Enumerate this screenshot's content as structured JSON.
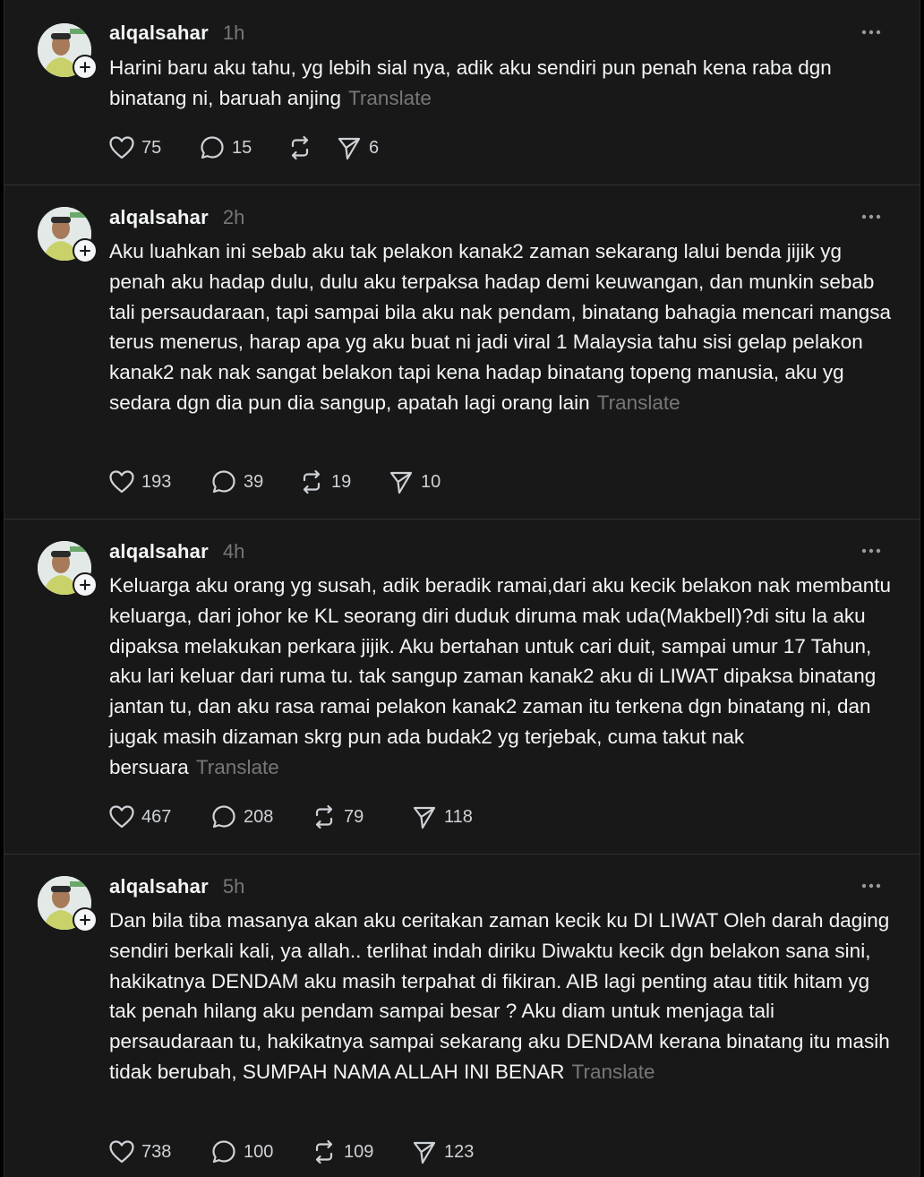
{
  "posts": [
    {
      "username": "alqalsahar",
      "time": "1h",
      "text": "Harini baru aku tahu, yg lebih sial nya, adik aku sendiri pun penah kena raba dgn binatang ni, baruah anjing",
      "translate_label": "Translate",
      "likes": "75",
      "replies": "15",
      "reposts": "",
      "shares": "6"
    },
    {
      "username": "alqalsahar",
      "time": "2h",
      "text": "Aku luahkan ini sebab aku tak pelakon kanak2 zaman sekarang lalui benda jijik yg penah aku hadap dulu, dulu aku terpaksa hadap demi keuwangan, dan munkin sebab tali persaudaraan, tapi sampai bila aku nak pendam, binatang bahagia mencari mangsa terus menerus, harap apa yg aku buat ni jadi viral 1 Malaysia tahu sisi gelap pelakon kanak2 nak nak sangat belakon tapi kena hadap binatang topeng manusia, aku yg sedara dgn dia pun dia sangup, apatah lagi orang lain",
      "translate_label": "Translate",
      "likes": "193",
      "replies": "39",
      "reposts": "19",
      "shares": "10"
    },
    {
      "username": "alqalsahar",
      "time": "4h",
      "text": "Keluarga aku orang yg susah, adik beradik ramai,dari aku kecik belakon nak membantu keluarga, dari johor ke KL seorang diri duduk diruma mak uda(Makbell)?di situ la aku dipaksa melakukan perkara jijik. Aku bertahan untuk cari duit, sampai umur 17 Tahun, aku lari keluar dari ruma tu. tak sangup zaman kanak2 aku di LIWAT dipaksa binatang jantan tu, dan aku rasa ramai pelakon kanak2 zaman itu terkena dgn binatang ni, dan jugak masih dizaman skrg pun ada budak2 yg terjebak, cuma takut nak bersuara",
      "translate_label": "Translate",
      "likes": "467",
      "replies": "208",
      "reposts": "79",
      "shares": "118"
    },
    {
      "username": "alqalsahar",
      "time": "5h",
      "text": "Dan bila tiba masanya akan aku ceritakan zaman kecik ku DI LIWAT Oleh darah daging sendiri berkali kali, ya allah.. terlihat indah diriku Diwaktu kecik dgn belakon sana sini, hakikatnya DENDAM aku masih terpahat di fikiran. AIB lagi penting atau titik hitam yg tak penah hilang aku pendam sampai besar ? Aku diam untuk menjaga tali persaudaraan tu, hakikatnya sampai sekarang aku DENDAM kerana binatang itu masih tidak berubah, SUMPAH NAMA ALLAH INI BENAR",
      "translate_label": "Translate",
      "likes": "738",
      "replies": "100",
      "reposts": "109",
      "shares": "123"
    }
  ]
}
